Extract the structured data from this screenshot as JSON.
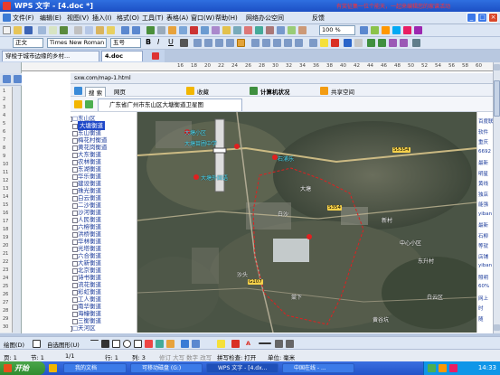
{
  "window": {
    "title": "WPS 文字 - [4.doc *]",
    "banner": "有奖征集一位个能天，一起来编辑您的家谱活动"
  },
  "menu": [
    "文件(F)",
    "编辑(E)",
    "视图(V)",
    "插入(I)",
    "格式(O)",
    "工具(T)",
    "表格(A)",
    "窗口(W)",
    "帮助(H)",
    "网络办公空间",
    "反馈"
  ],
  "format": {
    "style": "正文",
    "font": "Times New Roman",
    "size": "五号",
    "zoom": "100 %"
  },
  "doc_tabs": [
    "穿梭于城市边缘的乡村...",
    "4.doc"
  ],
  "ruler_marks": [
    "16",
    "18",
    "20",
    "22",
    "24",
    "26",
    "28",
    "30",
    "32",
    "34",
    "36",
    "38",
    "40",
    "42",
    "44",
    "46",
    "48",
    "50",
    "52",
    "54",
    "56",
    "58",
    "60"
  ],
  "vruler_marks": [
    "1",
    "2",
    "3",
    "4",
    "5",
    "6",
    "7",
    "8",
    "9",
    "10",
    "11",
    "12",
    "13",
    "14",
    "15",
    "16",
    "17",
    "18",
    "19",
    "20",
    "21",
    "22",
    "23",
    "24",
    "25",
    "26",
    "27",
    "28",
    "29",
    "30"
  ],
  "browser": {
    "address": "sxw.com/map-1.html",
    "toolbar": {
      "search": "搜 索",
      "search_site": "网页",
      "favorites": "收藏",
      "computer_status": "计算机状况",
      "share": "共享空间"
    },
    "tab": "广东省广州市东山区大塘衡道卫星图"
  },
  "tree_items": [
    {
      "label": "□东山区",
      "selected": false
    },
    {
      "label": "大塘衡道",
      "selected": true
    },
    {
      "label": "东山衡道",
      "selected": false
    },
    {
      "label": "梅花村衡道",
      "selected": false
    },
    {
      "label": "黄花岗衡道",
      "selected": false
    },
    {
      "label": "大东衡道",
      "selected": false
    },
    {
      "label": "农林衡道",
      "selected": false
    },
    {
      "label": "东湖衡道",
      "selected": false
    },
    {
      "label": "华乐衡道",
      "selected": false
    },
    {
      "label": "建设衡道",
      "selected": false
    },
    {
      "label": "珠光衡道",
      "selected": false
    },
    {
      "label": "白云衡道",
      "selected": false
    },
    {
      "label": "二沙衡道",
      "selected": false
    },
    {
      "label": "沙河衡道",
      "selected": false
    },
    {
      "label": "人民衡道",
      "selected": false
    },
    {
      "label": "六榕衡道",
      "selected": false
    },
    {
      "label": "洪桥衡道",
      "selected": false
    },
    {
      "label": "华林衡道",
      "selected": false
    },
    {
      "label": "光塔衡道",
      "selected": false
    },
    {
      "label": "六合衡道",
      "selected": false
    },
    {
      "label": "大新衡道",
      "selected": false
    },
    {
      "label": "北京衡道",
      "selected": false
    },
    {
      "label": "诗书衡道",
      "selected": false
    },
    {
      "label": "流花衡道",
      "selected": false
    },
    {
      "label": "彩虹衡道",
      "selected": false
    },
    {
      "label": "工人衡道",
      "selected": false
    },
    {
      "label": "南华衡道",
      "selected": false
    },
    {
      "label": "海幢衡道",
      "selected": false
    },
    {
      "label": "三衡衡道",
      "selected": false
    },
    {
      "label": "□天河区",
      "selected": false
    }
  ],
  "map_labels": [
    {
      "text": "大塘小区",
      "style": "cyan"
    },
    {
      "text": "大塘苗圃中学",
      "style": "cyan"
    },
    {
      "text": "石浦乐",
      "style": "cyan"
    },
    {
      "text": "大塘外国语",
      "style": "cyan"
    },
    {
      "text": "大塘",
      "style": "white"
    },
    {
      "text": "白沙",
      "style": "white"
    },
    {
      "text": "新村",
      "style": "white"
    },
    {
      "text": "中心小区",
      "style": "white"
    },
    {
      "text": "东升村",
      "style": "white"
    },
    {
      "text": "沙头",
      "style": "white"
    },
    {
      "text": "棠下",
      "style": "white"
    },
    {
      "text": "白云区",
      "style": "white"
    },
    {
      "text": "黄谷坑",
      "style": "white"
    }
  ],
  "road_labels": [
    "S5354",
    "S354",
    "G107"
  ],
  "ads": [
    "百度联盟",
    "软件",
    "重庆",
    "6692",
    "最新",
    "明星",
    "黄线",
    "独店",
    "能强",
    "yiban",
    "最新",
    "石柳",
    "等就",
    "店铺",
    "yiban",
    "照明",
    "60%",
    "网上",
    "时",
    "随"
  ],
  "drawbar": {
    "draw": "绘图(D)",
    "autoshapes": "自选图形(U)"
  },
  "status": {
    "page": "页: 1",
    "section": "节: 1",
    "pages": "1/1",
    "row": "行: 1",
    "col": "列: 3",
    "flags": "修订 大写 数字 改写",
    "spellcheck": "拼写检查: 打开",
    "unit": "单位: 毫米"
  },
  "taskbar": {
    "start": "开始",
    "items": [
      "我的文档",
      "可移动磁盘 (G:)",
      "WPS 文字 - [4.dx...",
      "中国在线 - ..."
    ],
    "clock": "14:33"
  }
}
